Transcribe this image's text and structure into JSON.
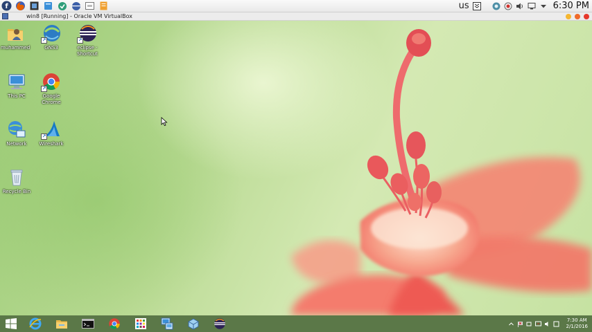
{
  "host_panel": {
    "launchers": [
      {
        "name": "fedora-icon",
        "glyph": "f",
        "color": "#294172"
      },
      {
        "name": "firefox-icon",
        "glyph": "",
        "color": "#e66000"
      },
      {
        "name": "screen-recorder-icon",
        "glyph": "",
        "color": "#333333"
      },
      {
        "name": "files-icon",
        "glyph": "",
        "color": "#3a8fd8"
      },
      {
        "name": "vpn-icon",
        "glyph": "",
        "color": "#2f9e7a"
      },
      {
        "name": "eclipse-icon",
        "glyph": "",
        "color": "#3b5ea8"
      },
      {
        "name": "terminal-icon",
        "glyph": "",
        "color": "#777777"
      },
      {
        "name": "notes-icon",
        "glyph": "",
        "color": "#f0a030"
      }
    ],
    "keyboard_layout": "us",
    "clock": "6:30 PM"
  },
  "vm_window": {
    "title": "win8 [Running] - Oracle VM VirtualBox",
    "button_colors": [
      "#f5b731",
      "#f06a2a",
      "#e6382c"
    ]
  },
  "desktop": {
    "icons": [
      {
        "label_lines": [
          "muhammed",
          ""
        ],
        "name": "user-folder-icon"
      },
      {
        "label_lines": [
          "GNS3",
          ""
        ],
        "name": "gns3-icon"
      },
      {
        "label_lines": [
          "eclipse -",
          "Shortcut"
        ],
        "name": "eclipse-shortcut-icon"
      },
      {
        "label_lines": [
          "This PC",
          ""
        ],
        "name": "this-pc-icon"
      },
      {
        "label_lines": [
          "Google",
          "Chrome"
        ],
        "name": "chrome-icon"
      },
      {
        "label_lines": [
          "Network",
          ""
        ],
        "name": "network-icon"
      },
      {
        "label_lines": [
          "Wireshark",
          ""
        ],
        "name": "wireshark-icon"
      },
      {
        "label_lines": [
          "Recycle Bin",
          ""
        ],
        "name": "recycle-bin-icon"
      }
    ]
  },
  "taskbar": {
    "items": [
      "start-icon",
      "internet-explorer-icon",
      "file-explorer-icon",
      "command-prompt-icon",
      "chrome-icon",
      "apps-grid-icon",
      "remote-desktop-icon",
      "virtualbox-icon",
      "eclipse-icon"
    ],
    "time": "7:30 AM",
    "date": "2/1/2016"
  }
}
